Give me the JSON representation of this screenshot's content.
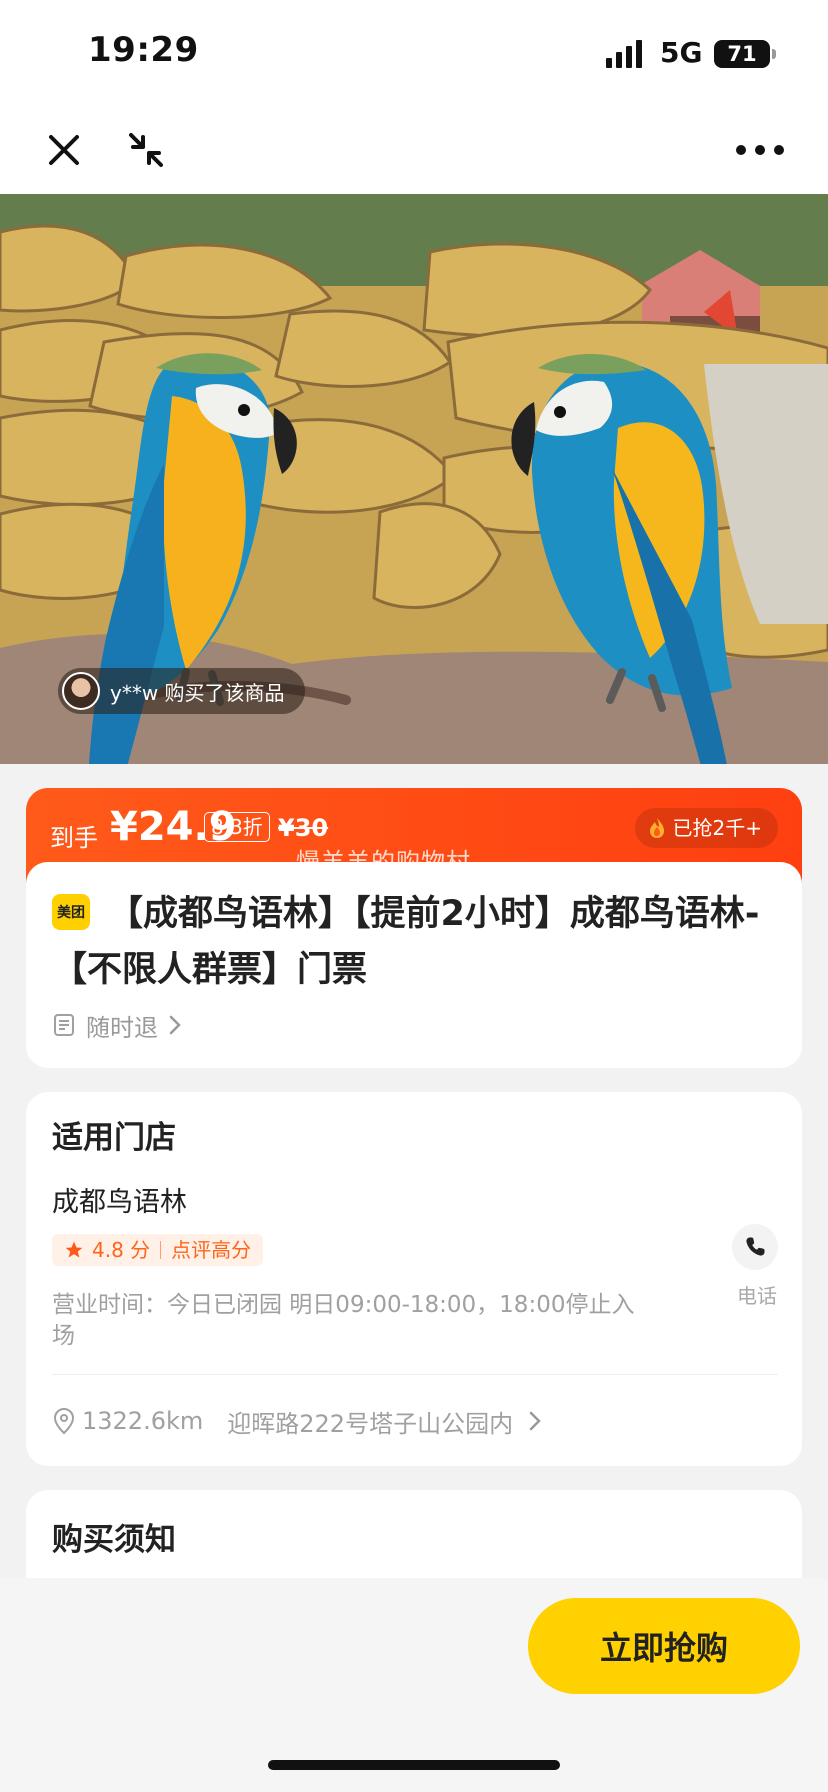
{
  "status_bar": {
    "time": "19:29",
    "network": "5G",
    "battery": "71"
  },
  "navigation": {
    "close_icon": "close-icon",
    "minimize_icon": "minimize-icon",
    "more_icon": "more-icon"
  },
  "hero": {
    "buyer_notice": "y**w 购买了该商品"
  },
  "price": {
    "prefix": "到手",
    "current": "¥24.9",
    "discount": "8.3折",
    "original": "¥30",
    "sold": "已抢2千+"
  },
  "watermark": "慢羊羊的购物村",
  "product": {
    "brand": "美团",
    "title": "【成都鸟语林】【提前2小时】成都鸟语林-【不限人群票】门票",
    "refund": "随时退"
  },
  "store": {
    "section_title": "适用门店",
    "name": "成都鸟语林",
    "rating": "4.8 分",
    "rating_note": "点评高分",
    "hours": "营业时间：今日已闭园 明日09:00-18:00，18:00停止入场",
    "phone_label": "电话",
    "distance": "1322.6km",
    "address": "迎晖路222号塔子山公园内"
  },
  "notice": {
    "title": "购买须知"
  },
  "footer": {
    "buy_button": "立即抢购"
  },
  "colors": {
    "accent_orange": "#ff4f14",
    "brand_yellow": "#ffd100",
    "rating_orange": "#ff6418"
  }
}
